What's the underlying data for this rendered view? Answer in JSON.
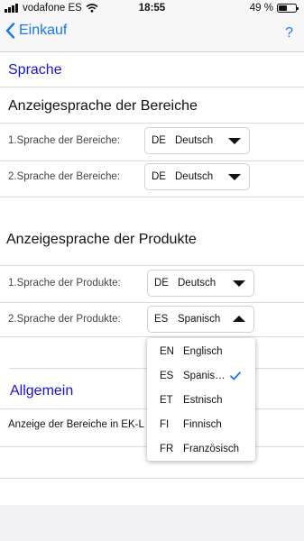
{
  "status_bar": {
    "carrier": "vodafone ES",
    "time": "18:55",
    "battery_text": "49 %",
    "battery_level": 0.49
  },
  "nav": {
    "back_label": "Einkauf",
    "help_label": "?"
  },
  "sections": {
    "language_title": "Sprache",
    "areas_title": "Anzeigesprache der Bereiche",
    "area_lang_1": {
      "label": "1.Sprache der Bereiche:",
      "code": "DE",
      "value": "Deutsch"
    },
    "area_lang_2": {
      "label": "2.Sprache der Bereiche:",
      "code": "DE",
      "value": "Deutsch"
    },
    "products_title": "Anzeigesprache der Produkte",
    "product_lang_1": {
      "label": "1.Sprache der Produkte:",
      "code": "DE",
      "value": "Deutsch"
    },
    "product_lang_2": {
      "label": "2.Sprache der Produkte:",
      "code": "ES",
      "value": "Spanisch"
    },
    "general_title": "Allgemein",
    "general_row": "Anzeige der Bereiche in EK-L"
  },
  "dropdown": {
    "options": [
      {
        "code": "EN",
        "label": "Englisch",
        "selected": false
      },
      {
        "code": "ES",
        "label": "Spanis…",
        "selected": true
      },
      {
        "code": "ET",
        "label": "Estnisch",
        "selected": false
      },
      {
        "code": "FI",
        "label": "Finnisch",
        "selected": false
      },
      {
        "code": "FR",
        "label": "Französisch",
        "selected": false
      }
    ]
  },
  "colors": {
    "accent": "#1877f2",
    "section_title": "#1414d8"
  }
}
